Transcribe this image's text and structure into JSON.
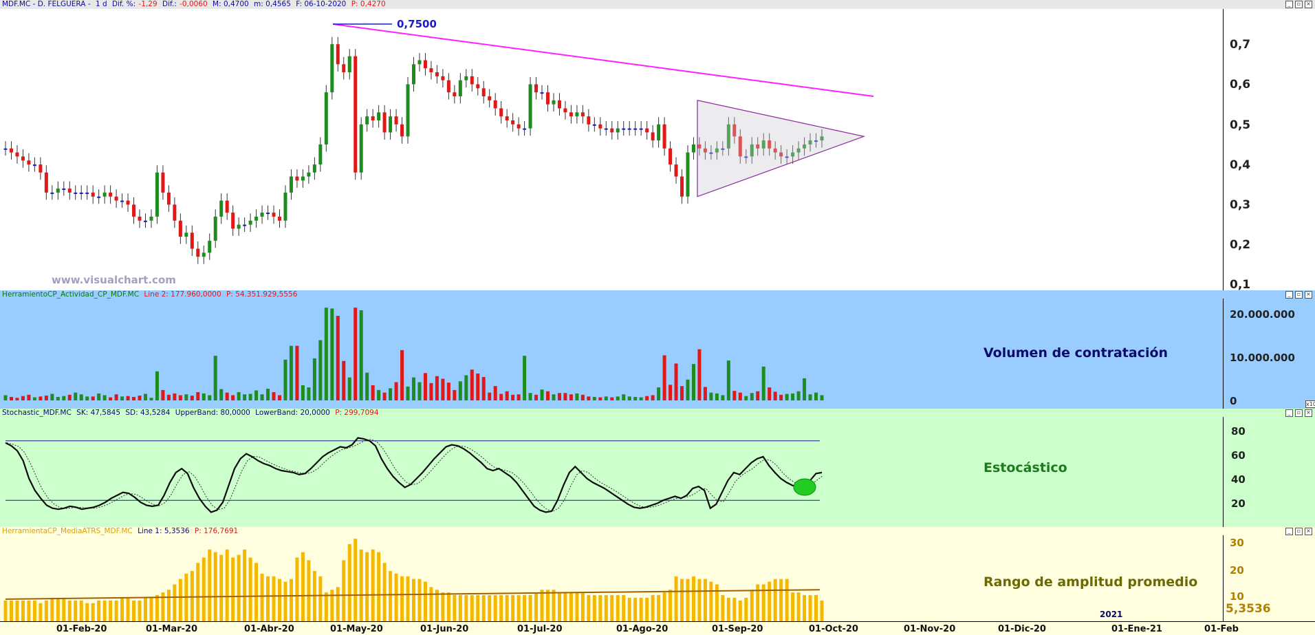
{
  "price_pane": {
    "header": {
      "symbol": "MDF.MC - D. FELGUERA -",
      "period": "1 d",
      "dif_pct_label": "Dif. %:",
      "dif_pct_value": "-1,29",
      "dif_label": "Dif.:",
      "dif_value": "-0,0060",
      "max": "M: 0,4700",
      "min": "m: 0,4565",
      "date": "F: 06-10-2020",
      "price": "P: 0,4270"
    },
    "y_ticks": [
      "0,7",
      "0,6",
      "0,5",
      "0,4",
      "0,3",
      "0,2",
      "0,1"
    ],
    "max_annotation": "0,7500",
    "watermark": "www.visualchart.com",
    "colors": {
      "up": "#1e8c1e",
      "down": "#e01818",
      "neutral": "#1a1acc",
      "trendline": "#ff1fff",
      "triangle": "#8a2a9a"
    }
  },
  "volume_pane": {
    "header": {
      "name": "HerramientoCP_Actividad_CP_MDF.MC",
      "line": "Line 2: 177.960,0000",
      "p": "P: 54.351.929,5556"
    },
    "label": "Volumen de contratación",
    "y_ticks": [
      "20.000.000",
      "10.000.000",
      "0"
    ],
    "corner": "x10",
    "bg": "#99ccff"
  },
  "stoch_pane": {
    "header": {
      "name": "Stochastic_MDF.MC",
      "sk": "SK: 47,5845",
      "sd": "SD: 43,5284",
      "upper": "UpperBand: 80,0000",
      "lower": "LowerBand: 20,0000",
      "p": "P: 299,7094"
    },
    "label": "Estocástico",
    "y_ticks": [
      "80",
      "60",
      "40",
      "20"
    ],
    "bg": "#ccffcc"
  },
  "atr_pane": {
    "header": {
      "name": "HerramientaCP_MediaATRS_MDF.MC",
      "line": "Line 1: 5,3536",
      "p": "P: 176,7691"
    },
    "label": "Rango de amplitud promedio",
    "y_ticks": [
      "30",
      "20",
      "10"
    ],
    "current_value": "5,3536",
    "year_marker": "2021",
    "bg": "#ffffe0"
  },
  "x_axis": {
    "labels": [
      "01-Feb-20",
      "01-Mar-20",
      "01-Abr-20",
      "01-May-20",
      "01-Jun-20",
      "01-Jul-20",
      "01-Ago-20",
      "01-Sep-20",
      "01-Oct-20",
      "01-Nov-20",
      "01-Dic-20",
      "01-Ene-21",
      "01-Feb"
    ]
  },
  "chart_data": {
    "type": "candlestick",
    "title": "MDF.MC - D. FELGUERA",
    "price_close_series": {
      "x_start": "2020-01-02",
      "period": "daily",
      "values": [
        0.44,
        0.43,
        0.42,
        0.41,
        0.4,
        0.4,
        0.38,
        0.33,
        0.33,
        0.34,
        0.34,
        0.33,
        0.33,
        0.33,
        0.33,
        0.32,
        0.32,
        0.33,
        0.32,
        0.31,
        0.31,
        0.3,
        0.27,
        0.26,
        0.26,
        0.27,
        0.38,
        0.33,
        0.3,
        0.26,
        0.22,
        0.23,
        0.19,
        0.17,
        0.18,
        0.21,
        0.27,
        0.31,
        0.28,
        0.24,
        0.25,
        0.25,
        0.26,
        0.27,
        0.28,
        0.28,
        0.27,
        0.26,
        0.33,
        0.37,
        0.36,
        0.37,
        0.38,
        0.4,
        0.45,
        0.58,
        0.7,
        0.65,
        0.63,
        0.67,
        0.38,
        0.5,
        0.52,
        0.51,
        0.53,
        0.48,
        0.52,
        0.5,
        0.47,
        0.6,
        0.65,
        0.66,
        0.64,
        0.63,
        0.62,
        0.61,
        0.58,
        0.57,
        0.61,
        0.62,
        0.6,
        0.59,
        0.57,
        0.56,
        0.54,
        0.52,
        0.51,
        0.5,
        0.49,
        0.49,
        0.6,
        0.58,
        0.58,
        0.55,
        0.56,
        0.54,
        0.53,
        0.52,
        0.53,
        0.52,
        0.5,
        0.5,
        0.49,
        0.49,
        0.48,
        0.49,
        0.49,
        0.49,
        0.49,
        0.49,
        0.48,
        0.46,
        0.5,
        0.44,
        0.4,
        0.37,
        0.32,
        0.43,
        0.45,
        0.44,
        0.43,
        0.43,
        0.44,
        0.44,
        0.5,
        0.47,
        0.42,
        0.42,
        0.45,
        0.44,
        0.46,
        0.44,
        0.43,
        0.42,
        0.42,
        0.43,
        0.44,
        0.45,
        0.46,
        0.46,
        0.47
      ]
    },
    "max_price": 0.75,
    "trendline": {
      "from": {
        "date": "2020-05-01",
        "value": 0.75
      },
      "to": {
        "date": "2020-10-06",
        "value": 0.57
      }
    },
    "triangle": {
      "apex_value": 0.47,
      "top_value": 0.56,
      "bottom_value": 0.32
    },
    "volume_series_millions": [
      1.2,
      0.8,
      0.6,
      1.0,
      1.3,
      0.7,
      0.9,
      1.1,
      1.5,
      0.8,
      1.0,
      1.3,
      1.8,
      1.4,
      0.9,
      0.9,
      1.6,
      1.2,
      0.7,
      1.4,
      0.9,
      1.0,
      0.8,
      1.1,
      1.5,
      0.6,
      6.7,
      2.4,
      1.3,
      1.6,
      1.2,
      1.4,
      1.1,
      1.9,
      1.6,
      1.2,
      10.3,
      2.6,
      1.8,
      1.2,
      1.9,
      1.4,
      1.5,
      2.3,
      1.4,
      2.7,
      1.9,
      1.2,
      9.4,
      12.6,
      12.6,
      3.5,
      3.0,
      9.7,
      13.9,
      21.4,
      21.2,
      19.5,
      9.1,
      5.3,
      21.4,
      20.8,
      6.4,
      3.5,
      2.4,
      1.8,
      2.8,
      4.2,
      11.6,
      3.2,
      5.3,
      4.2,
      6.3,
      4.0,
      5.6,
      5.0,
      4.1,
      2.4,
      4.4,
      5.8,
      7.1,
      6.2,
      5.4,
      1.8,
      3.3,
      1.5,
      2.1,
      1.3,
      1.4,
      10.3,
      1.7,
      1.3,
      2.5,
      2.1,
      1.4,
      1.7,
      1.7,
      1.4,
      1.6,
      1.3,
      0.9,
      0.8,
      0.7,
      0.9,
      0.7,
      0.9,
      1.4,
      0.9,
      0.8,
      0.7,
      1.0,
      1.2,
      3.0,
      10.4,
      3.6,
      8.5,
      3.3,
      4.8,
      8.4,
      11.8,
      3.1,
      1.8,
      1.6,
      1.2,
      9.2,
      2.2,
      1.8,
      1.0,
      1.7,
      2.1,
      7.8,
      3.0,
      2.0,
      1.3,
      1.5,
      1.6,
      2.1,
      5.1,
      1.4,
      1.8,
      1.2
    ],
    "stochastic": {
      "upper_band": 80,
      "lower_band": 20,
      "sk": [
        78,
        75,
        70,
        60,
        42,
        30,
        22,
        15,
        12,
        11,
        12,
        14,
        13,
        11,
        12,
        13,
        15,
        18,
        22,
        25,
        28,
        27,
        23,
        18,
        15,
        14,
        15,
        25,
        38,
        48,
        52,
        47,
        33,
        22,
        14,
        8,
        10,
        18,
        35,
        52,
        62,
        67,
        64,
        60,
        57,
        55,
        52,
        50,
        49,
        48,
        46,
        47,
        52,
        58,
        64,
        68,
        71,
        74,
        73,
        76,
        83,
        82,
        80,
        75,
        62,
        52,
        44,
        38,
        33,
        36,
        42,
        48,
        55,
        62,
        68,
        74,
        76,
        75,
        72,
        68,
        63,
        58,
        52,
        50,
        52,
        48,
        44,
        38,
        30,
        22,
        14,
        10,
        8,
        9,
        20,
        35,
        48,
        54,
        48,
        42,
        38,
        35,
        32,
        28,
        24,
        20,
        16,
        13,
        12,
        13,
        15,
        17,
        20,
        22,
        24,
        22,
        25,
        32,
        34,
        30,
        12,
        16,
        28,
        40,
        48,
        46,
        52,
        58,
        62,
        64,
        55,
        48,
        42,
        38,
        35,
        33,
        35,
        40,
        47,
        48
      ]
    },
    "atr_series": [
      8,
      8,
      8,
      8,
      8,
      8,
      7,
      8,
      9,
      9,
      9,
      8,
      8,
      8,
      7,
      7,
      8,
      8,
      8,
      8,
      9,
      9,
      8,
      8,
      9,
      9,
      10,
      11,
      12,
      14,
      16,
      18,
      19,
      22,
      24,
      27,
      26,
      25,
      27,
      24,
      25,
      27,
      24,
      22,
      18,
      17,
      17,
      16,
      15,
      16,
      24,
      26,
      23,
      19,
      17,
      11,
      12,
      13,
      23,
      29,
      31,
      27,
      26,
      27,
      26,
      22,
      19,
      18,
      17,
      17,
      16,
      16,
      15,
      13,
      12,
      11,
      11,
      10,
      10,
      10,
      10,
      10,
      10,
      10,
      10,
      10,
      10,
      10,
      10,
      10,
      10,
      11,
      12,
      12,
      12,
      11,
      11,
      11,
      11,
      11,
      10,
      10,
      10,
      10,
      10,
      10,
      10,
      9,
      9,
      9,
      9,
      10,
      10,
      11,
      12,
      17,
      16,
      16,
      17,
      16,
      16,
      15,
      14,
      10,
      9,
      9,
      8,
      9,
      12,
      14,
      14,
      15,
      16,
      16,
      16,
      11,
      11,
      10,
      10,
      10,
      8
    ],
    "atr_average_line": 10.5
  }
}
